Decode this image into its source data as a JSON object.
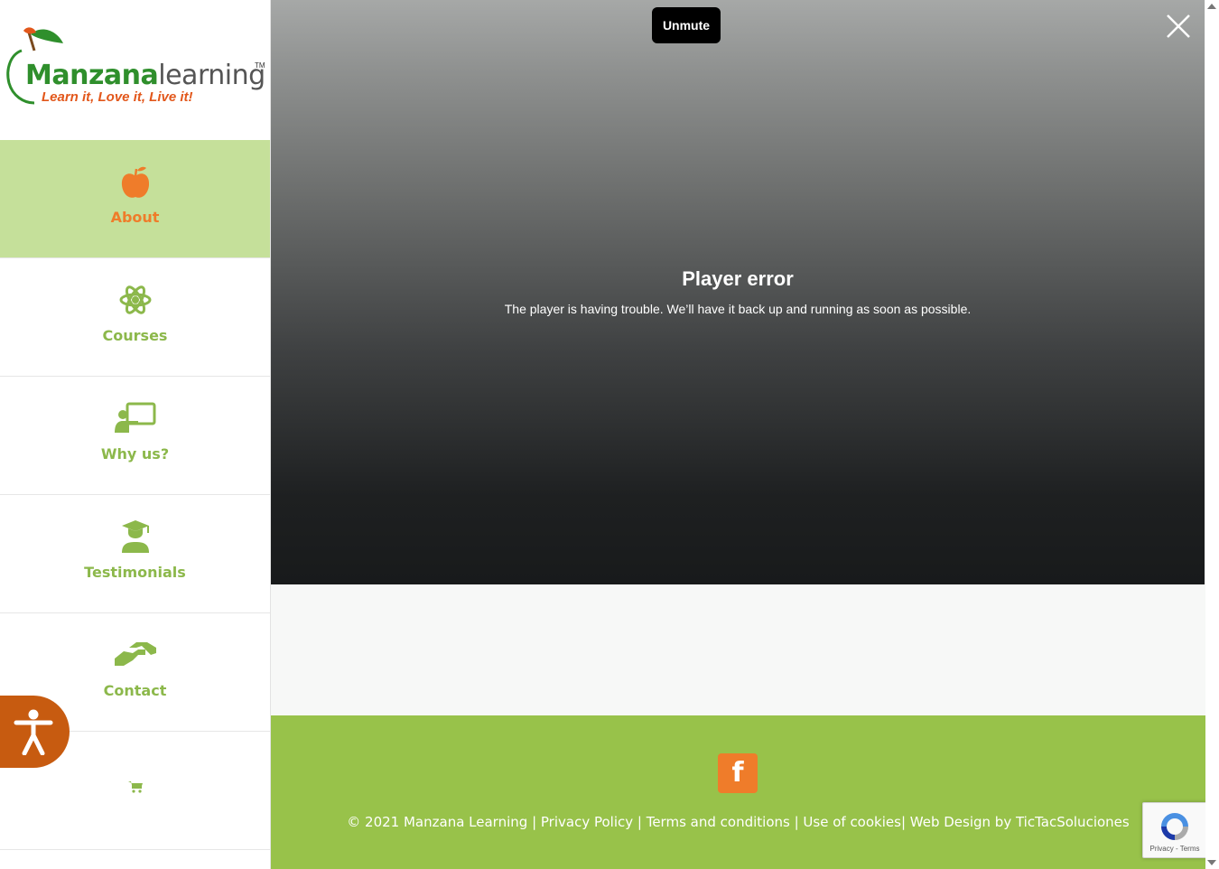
{
  "logo": {
    "brand_strong": "Manzana",
    "brand_light": "learning",
    "trademark": "TM",
    "tagline": "Learn it, Love it, Live it!"
  },
  "nav": {
    "items": [
      {
        "label": "About",
        "icon": "apple-icon",
        "active": true
      },
      {
        "label": "Courses",
        "icon": "atom-icon",
        "active": false
      },
      {
        "label": "Why us?",
        "icon": "presentation-icon",
        "active": false
      },
      {
        "label": "Testimonials",
        "icon": "graduate-icon",
        "active": false
      },
      {
        "label": "Contact",
        "icon": "handshake-icon",
        "active": false
      },
      {
        "label": "",
        "icon": "cart-icon",
        "active": false
      }
    ]
  },
  "video": {
    "unmute_label": "Unmute",
    "error_title": "Player error",
    "error_message": "The player is having trouble. We’ll have it back up and running as soon as possible."
  },
  "footer": {
    "facebook_letter": "f",
    "copyright": "© 2021 Manzana Learning",
    "sep1": " | ",
    "privacy": "Privacy Policy",
    "sep2": " | ",
    "terms": "Terms and conditions",
    "sep3": " | ",
    "cookies": "Use of cookies",
    "sep4": "| ",
    "webdesign": "Web Design by TicTacSoluciones"
  },
  "recaptcha": {
    "text": "Privacy - Terms"
  },
  "colors": {
    "brand_green": "#98c24a",
    "active_nav": "#c5e09a",
    "accent_orange": "#ef7c2a",
    "accessibility": "#c75b10"
  }
}
